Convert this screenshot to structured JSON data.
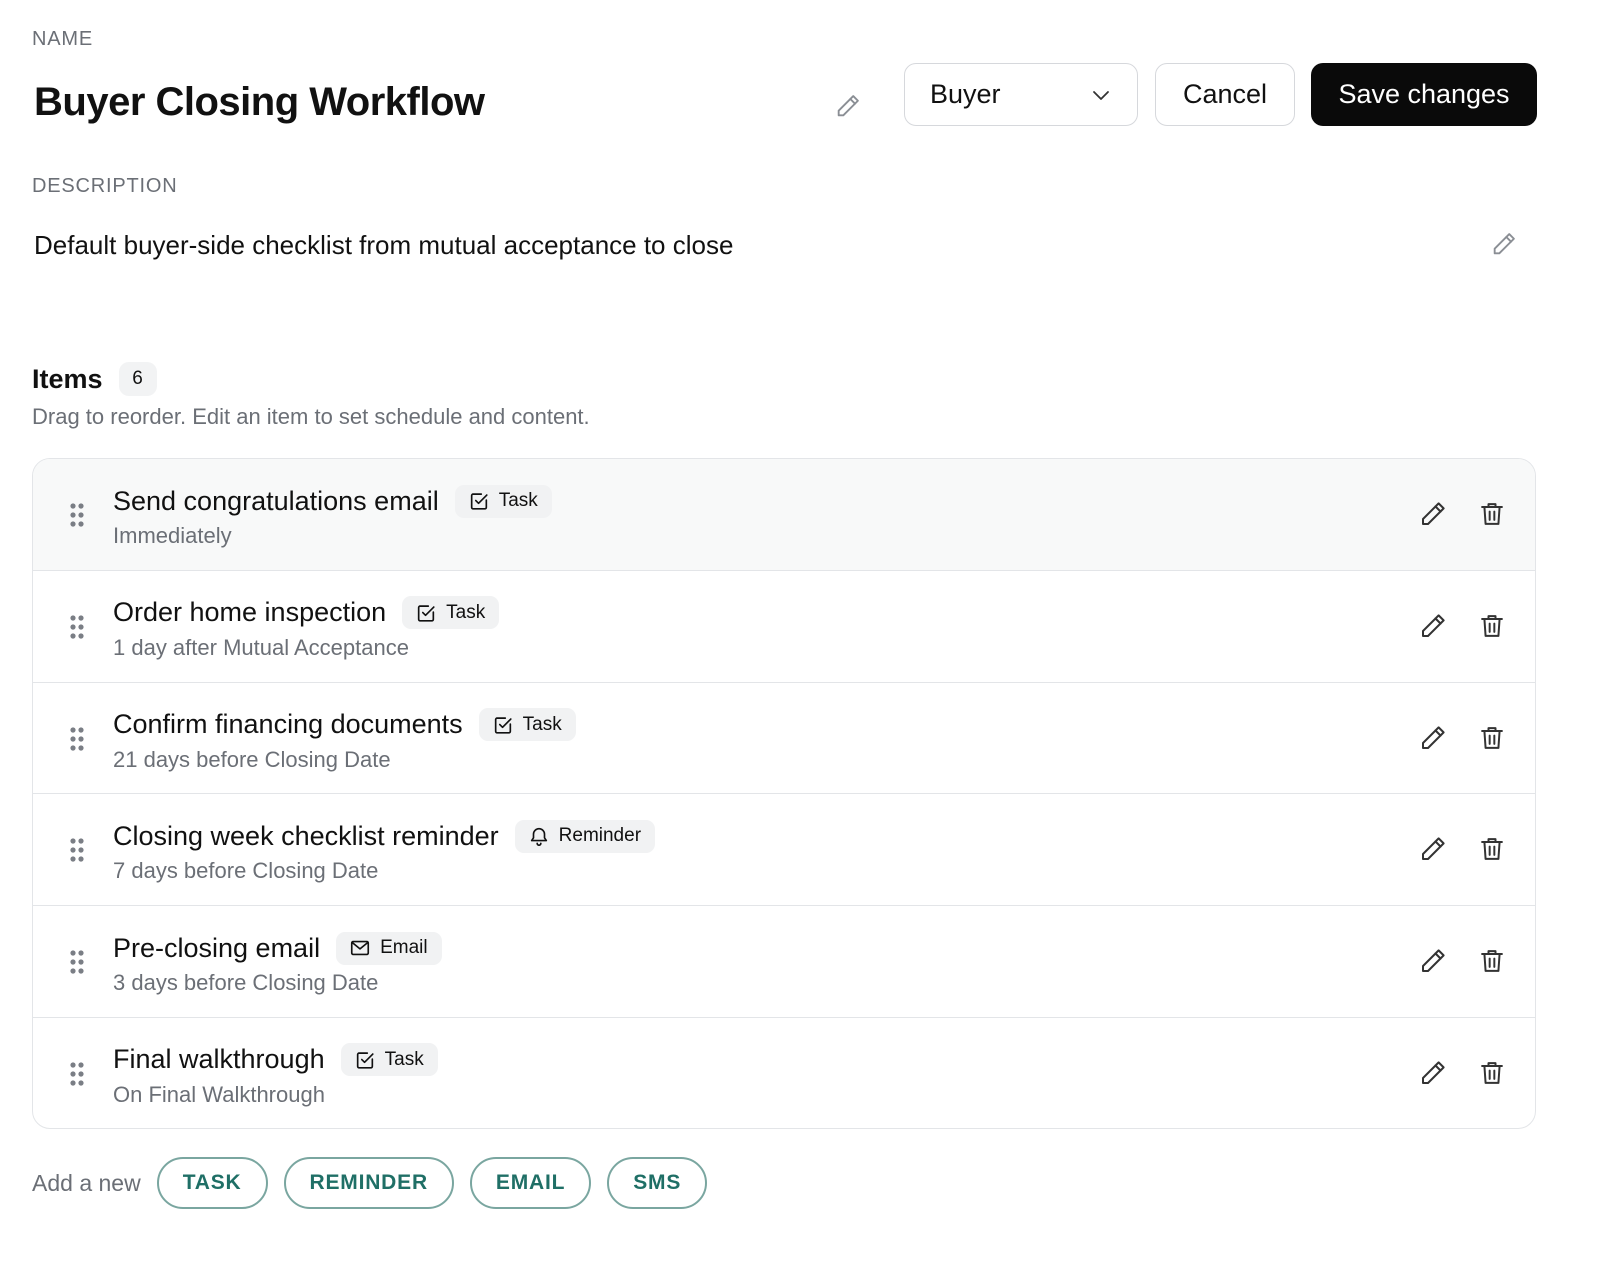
{
  "name_section": {
    "label": "NAME",
    "value": "Buyer Closing Workflow"
  },
  "role_select": {
    "value": "Buyer"
  },
  "actions": {
    "cancel_label": "Cancel",
    "save_label": "Save changes"
  },
  "description_section": {
    "label": "DESCRIPTION",
    "value": "Default buyer-side checklist from mutual acceptance to close"
  },
  "items_section": {
    "heading": "Items",
    "count": "6",
    "hint": "Drag to reorder. Edit an item to set schedule and content."
  },
  "items": [
    {
      "title": "Send congratulations email",
      "type": "Task",
      "type_icon": "checkbox-icon",
      "schedule": "Immediately"
    },
    {
      "title": "Order home inspection",
      "type": "Task",
      "type_icon": "checkbox-icon",
      "schedule": "1 day after Mutual Acceptance"
    },
    {
      "title": "Confirm financing documents",
      "type": "Task",
      "type_icon": "checkbox-icon",
      "schedule": "21 days before Closing Date"
    },
    {
      "title": "Closing week checklist reminder",
      "type": "Reminder",
      "type_icon": "bell-icon",
      "schedule": "7 days before Closing Date"
    },
    {
      "title": "Pre-closing email",
      "type": "Email",
      "type_icon": "mail-icon",
      "schedule": "3 days before Closing Date"
    },
    {
      "title": "Final walkthrough",
      "type": "Task",
      "type_icon": "checkbox-icon",
      "schedule": "On Final Walkthrough"
    }
  ],
  "add_new": {
    "label": "Add a new",
    "buttons": [
      "TASK",
      "REMINDER",
      "EMAIL",
      "SMS"
    ]
  },
  "colors": {
    "primary_button": "#0a0a0a",
    "accent_teal": "#1f6f66",
    "muted_text": "#6b6f76",
    "border": "#e3e5e8"
  }
}
